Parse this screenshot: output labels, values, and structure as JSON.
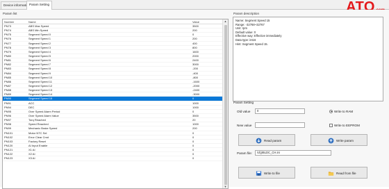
{
  "tabs": [
    {
      "label": "Device information"
    },
    {
      "label": "Param Setting"
    }
  ],
  "brand": {
    "logo": "ATO",
    "suffix": ".com"
  },
  "param_list": {
    "title": "Param list",
    "columns": [
      "Number",
      "Name",
      "Value"
    ],
    "rows": [
      {
        "number": "PN73",
        "name": "ABS Max Speed",
        "value": "3500"
      },
      {
        "number": "PN74",
        "name": "ABS Min Speed",
        "value": "200"
      },
      {
        "number": "PN75",
        "name": "Segment Speed 0",
        "value": "0"
      },
      {
        "number": "PN76",
        "name": "Segment Speed 1",
        "value": "200"
      },
      {
        "number": "PN77",
        "name": "Segment Speed 2",
        "value": "400"
      },
      {
        "number": "PN78",
        "name": "Segment Speed 3",
        "value": "800"
      },
      {
        "number": "PN79",
        "name": "Segment Speed 4",
        "value": "1600"
      },
      {
        "number": "PN80",
        "name": "Segment Speed 5",
        "value": "2000"
      },
      {
        "number": "PN81",
        "name": "Segment Speed 6",
        "value": "2400"
      },
      {
        "number": "PN82",
        "name": "Segment Speed 7",
        "value": "3000"
      },
      {
        "number": "PN83",
        "name": "Segment Speed 8",
        "value": "-200"
      },
      {
        "number": "PN84",
        "name": "Segment Speed 9",
        "value": "-400"
      },
      {
        "number": "PN85",
        "name": "Segment Speed 10",
        "value": "-800"
      },
      {
        "number": "PN86",
        "name": "Segment Speed 11",
        "value": "-1600"
      },
      {
        "number": "PN87",
        "name": "Segment Speed 12",
        "value": "-2000"
      },
      {
        "number": "PN88",
        "name": "Segment Speed 13",
        "value": "-2400"
      },
      {
        "number": "PN89",
        "name": "Segment Speed 14",
        "value": "-3000"
      },
      {
        "number": "PN90",
        "name": "Segment Speed 15",
        "value": "0",
        "selected": true
      },
      {
        "number": "PN91",
        "name": "ACC",
        "value": "1000"
      },
      {
        "number": "PN94",
        "name": "DEC",
        "value": "1000"
      },
      {
        "number": "PN95",
        "name": "Over Speed Alarm Period",
        "value": "0"
      },
      {
        "number": "PN96",
        "name": "Over Speed Alarm Value",
        "value": "3500"
      },
      {
        "number": "PN97",
        "name": "Torq Reached",
        "value": "20"
      },
      {
        "number": "PN98",
        "name": "Speed Reached",
        "value": "1000"
      },
      {
        "number": "PN99",
        "name": "Mechanic Brake Speed",
        "value": "200"
      },
      {
        "number": "PN101",
        "name": "Motor NTC Sel",
        "value": "0"
      },
      {
        "number": "PN102",
        "name": "Error Clear Cmd",
        "value": "0"
      },
      {
        "number": "PN103",
        "name": "Factory Reset",
        "value": "0"
      },
      {
        "number": "PN120",
        "name": "AI Input Enable",
        "value": "0"
      },
      {
        "number": "PN121",
        "name": "X1 AI",
        "value": "0"
      },
      {
        "number": "PN122",
        "name": "X2 AI",
        "value": "0"
      },
      {
        "number": "PN123",
        "name": "X3 AI",
        "value": "0"
      }
    ]
  },
  "param_description": {
    "title": "Param description",
    "lines": [
      "Name: Segment Speed 15",
      "Range: -32768~32767",
      "Unit: rpm",
      "Default value: 0",
      "Effective way: Effective immediately",
      "Data type: int16",
      "Hint: Segment Speed 15."
    ]
  },
  "param_setting": {
    "title": "Param Setting",
    "old_value_label": "Old value",
    "old_value": "0",
    "write_ram_label": "Write to RAM",
    "new_value_label": "New value",
    "new_value": "",
    "write_eeprom_label": "Write to EEPROM",
    "read_param_label": "Read param",
    "write_param_label": "Write param",
    "param_file_label": "Param file:",
    "param_file_value": "\\cfg\\BLDC_CH.ini",
    "write_file_label": "Write to file",
    "read_file_label": "Read from file"
  },
  "colors": {
    "selected_row": "#0a78d7",
    "logo_red": "#e3181b"
  }
}
